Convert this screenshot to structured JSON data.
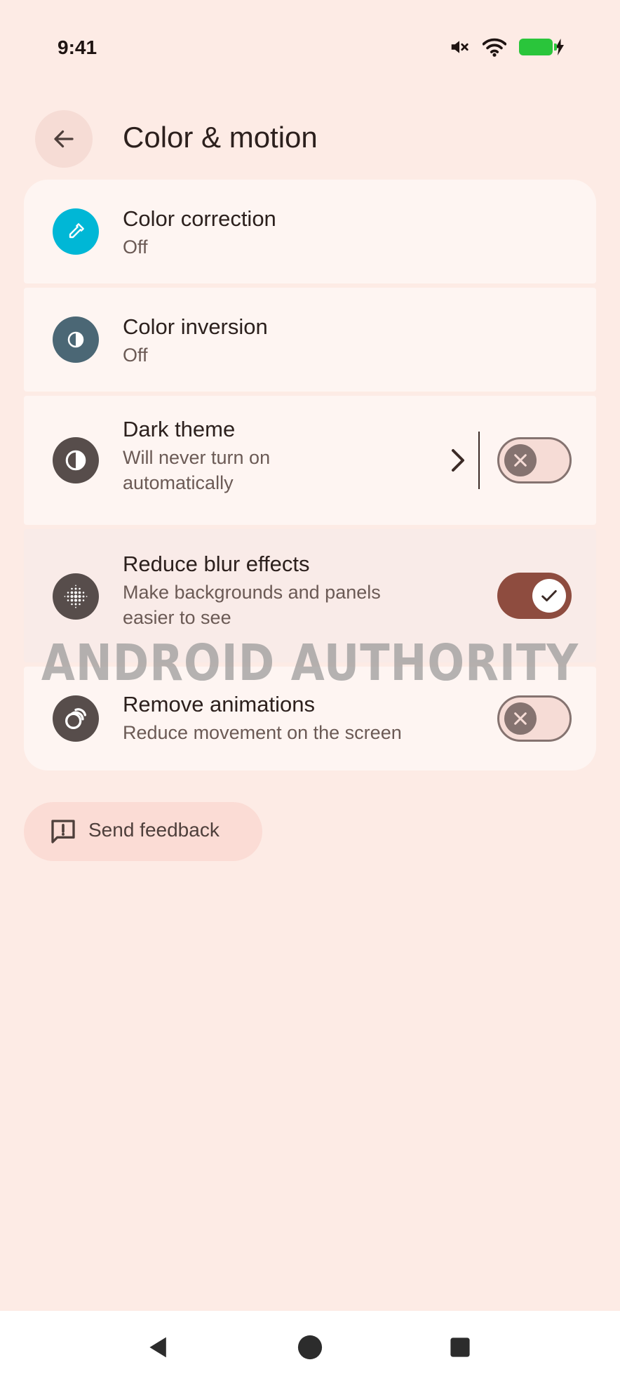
{
  "status_bar": {
    "time": "9:41",
    "icons": [
      "mute-icon",
      "wifi-icon",
      "battery-charging-icon"
    ]
  },
  "header": {
    "title": "Color & motion",
    "back_icon": "arrow-back-icon"
  },
  "settings": [
    {
      "title": "Color correction",
      "subtitle": "Off",
      "icon": "eyedropper-icon",
      "icon_color": "#00b7d6"
    },
    {
      "title": "Color inversion",
      "subtitle": "Off",
      "icon": "color-inversion-icon",
      "icon_color": "#4b6775"
    },
    {
      "title": "Dark theme",
      "subtitle_line1": "Will never turn on",
      "subtitle_line2": "automatically",
      "icon": "dark-theme-icon",
      "icon_color": "#574d4b",
      "toggle": "off"
    },
    {
      "title": "Reduce blur effects",
      "subtitle_line1": "Make backgrounds and panels",
      "subtitle_line2": "easier to see",
      "icon": "blur-dots-icon",
      "icon_color": "#574d4b",
      "toggle": "on"
    },
    {
      "title": "Remove animations",
      "subtitle": "Reduce movement on the screen",
      "icon": "animation-rings-icon",
      "icon_color": "#574d4b",
      "toggle": "off"
    }
  ],
  "watermark": "ANDROID AUTHORITY",
  "feedback": {
    "label": "Send feedback",
    "icon": "feedback-icon"
  },
  "colors": {
    "background": "#fdebe5",
    "card": "#fef5f2",
    "toggle_on": "#8e4c3f",
    "toggle_off_outline": "#857370"
  },
  "nav": [
    "back-triangle-icon",
    "home-circle-icon",
    "recents-square-icon"
  ]
}
